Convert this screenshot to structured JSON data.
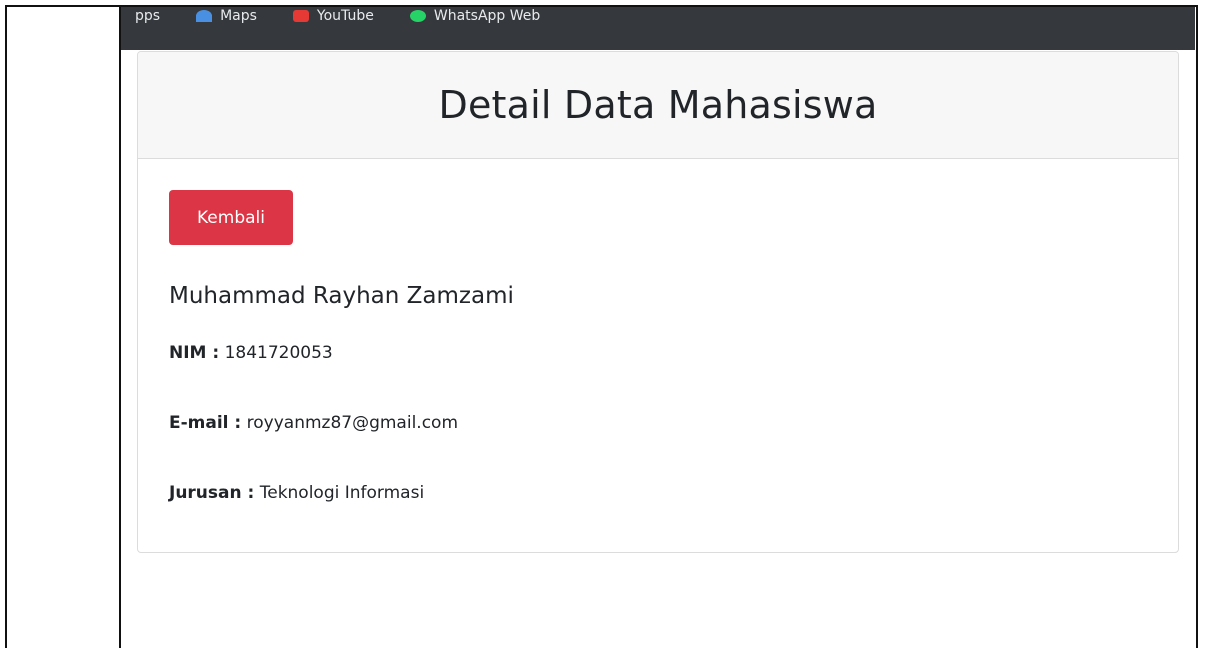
{
  "bookmarks": [
    {
      "label": "pps",
      "icon": "apps-icon"
    },
    {
      "label": "Maps",
      "icon": "maps-icon"
    },
    {
      "label": "YouTube",
      "icon": "youtube-icon"
    },
    {
      "label": "WhatsApp Web",
      "icon": "whatsapp-icon"
    }
  ],
  "card": {
    "title": "Detail Data Mahasiswa",
    "back_button": "Kembali"
  },
  "student": {
    "name": "Muhammad Rayhan Zamzami",
    "nim_label": "NIM :",
    "nim": "1841720053",
    "email_label": "E-mail :",
    "email": "royyanmz87@gmail.com",
    "jurusan_label": "Jurusan :",
    "jurusan": "Teknologi Informasi"
  },
  "colors": {
    "danger": "#dc3545",
    "header_bg": "#f7f7f7",
    "browser_bar": "#35383c"
  }
}
